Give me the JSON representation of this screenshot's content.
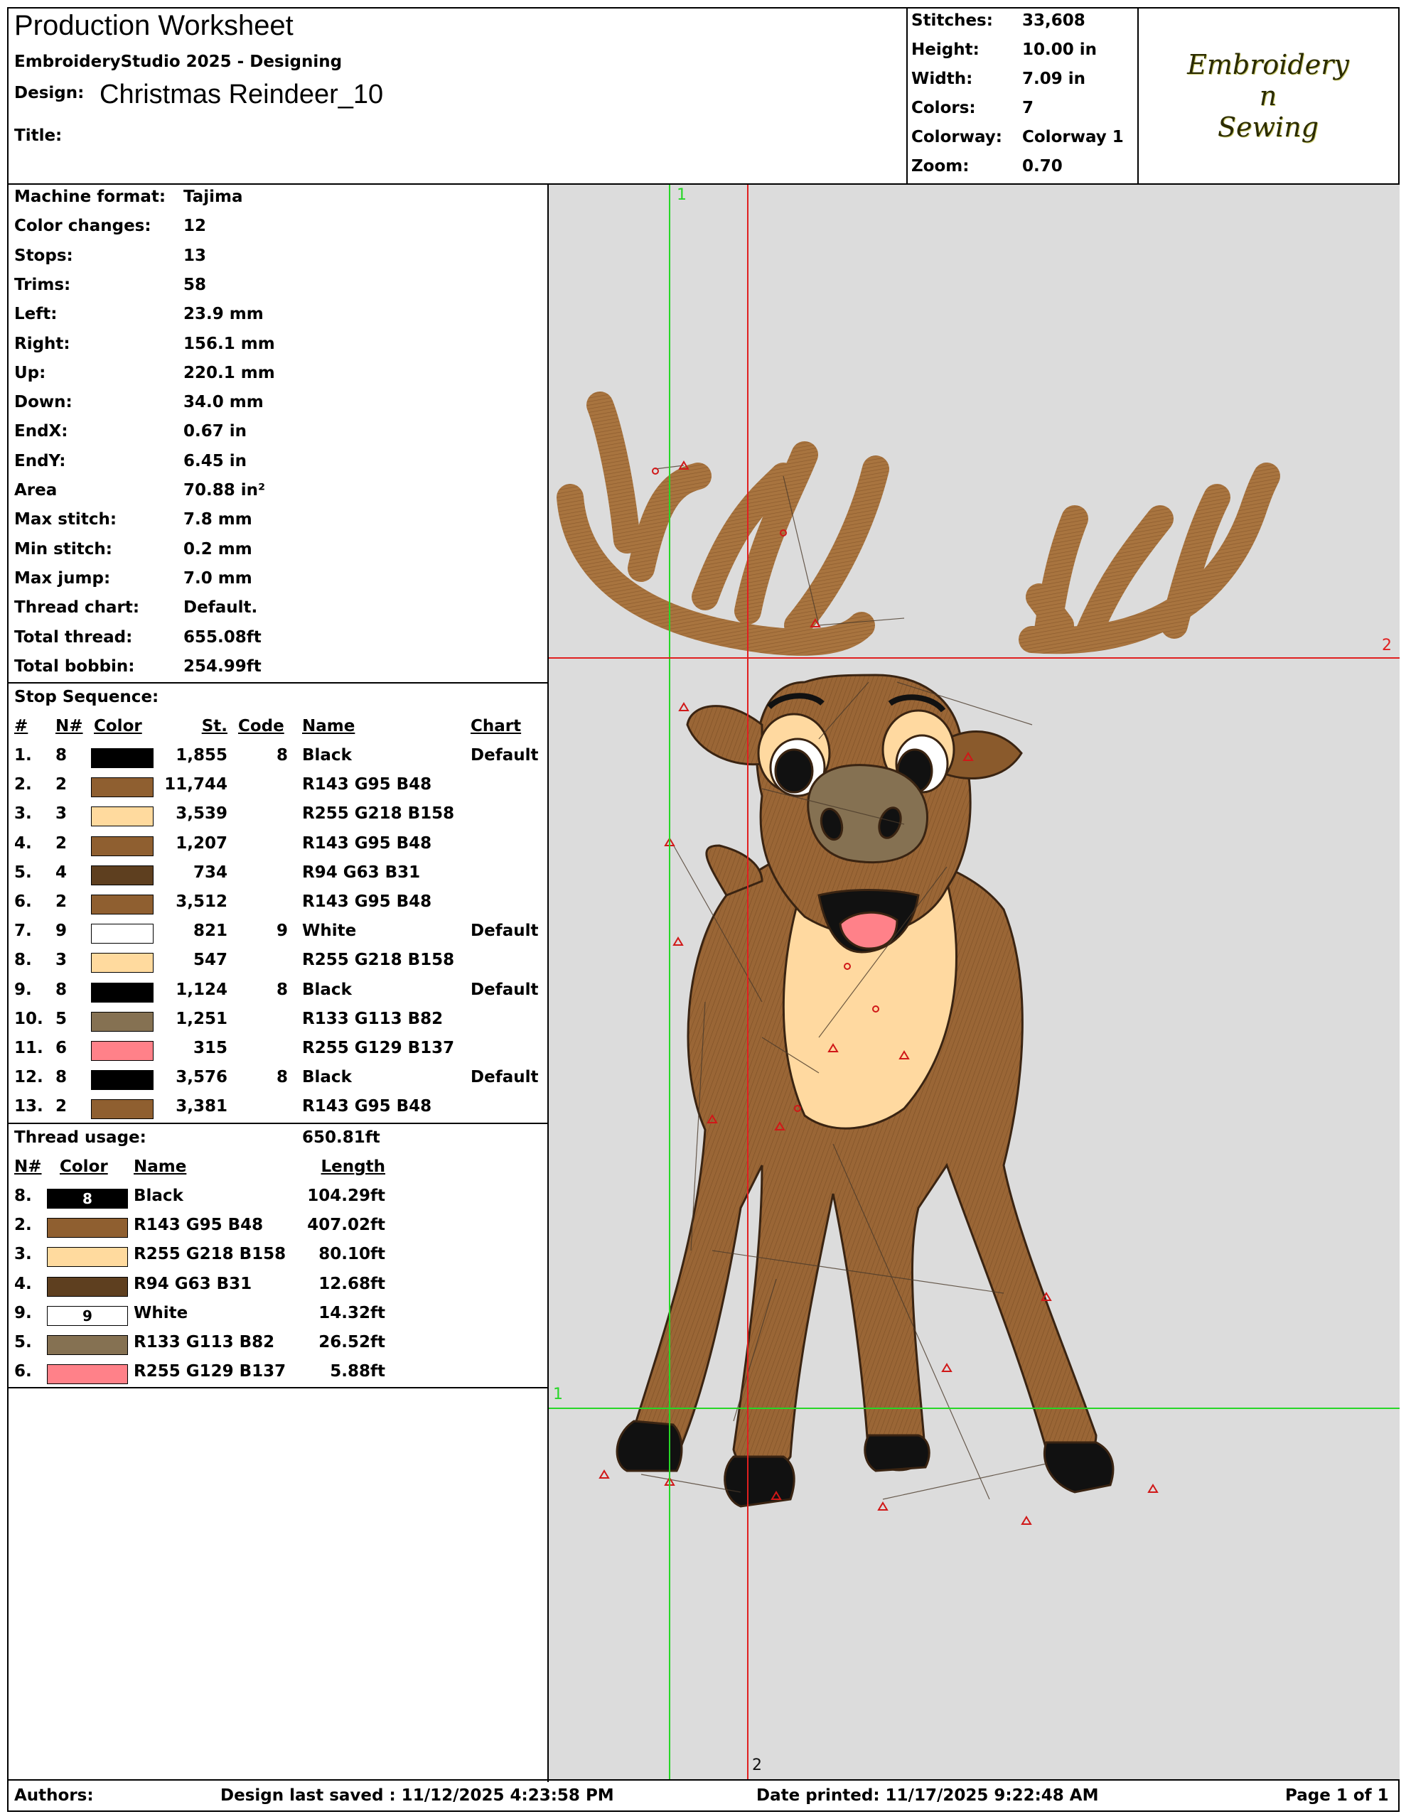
{
  "header": {
    "title": "Production Worksheet",
    "software": "EmbroideryStudio 2025 - Designing",
    "design_label": "Design:",
    "design_name": "Christmas Reindeer_10",
    "title_label": "Title:",
    "title_value": ""
  },
  "summary": {
    "stitches_label": "Stitches:",
    "stitches": "33,608",
    "height_label": "Height:",
    "height": "10.00 in",
    "width_label": "Width:",
    "width": "7.09 in",
    "colors_label": "Colors:",
    "colors": "7",
    "colorway_label": "Colorway:",
    "colorway": "Colorway 1",
    "zoom_label": "Zoom:",
    "zoom": "0.70"
  },
  "logo": {
    "line1": "Embroidery",
    "line2": "n",
    "line3": "Sewing"
  },
  "machine_info": [
    {
      "label": "Machine format:",
      "value": "Tajima"
    },
    {
      "label": "Color changes:",
      "value": "12"
    },
    {
      "label": "Stops:",
      "value": "13"
    },
    {
      "label": "Trims:",
      "value": "58"
    },
    {
      "label": "Left:",
      "value": "23.9 mm"
    },
    {
      "label": "Right:",
      "value": "156.1 mm"
    },
    {
      "label": "Up:",
      "value": "220.1 mm"
    },
    {
      "label": "Down:",
      "value": "34.0 mm"
    },
    {
      "label": "EndX:",
      "value": "0.67 in"
    },
    {
      "label": "EndY:",
      "value": "6.45 in"
    },
    {
      "label": "Area",
      "value": " 70.88 in²"
    },
    {
      "label": "Max stitch:",
      "value": "7.8 mm"
    },
    {
      "label": "Min stitch:",
      "value": "0.2 mm"
    },
    {
      "label": "Max jump:",
      "value": "7.0 mm"
    },
    {
      "label": "Thread chart:",
      "value": "Default."
    },
    {
      "label": "Total thread:",
      "value": "655.08ft"
    },
    {
      "label": "Total bobbin:",
      "value": "254.99ft"
    }
  ],
  "stop_sequence": {
    "title": "Stop Sequence:",
    "headers": {
      "num": "#",
      "n": "N#",
      "color": "Color",
      "st": "St.",
      "code": "Code",
      "name": "Name",
      "chart": "Chart"
    },
    "rows": [
      {
        "num": "1.",
        "n": "8",
        "color": "#000000",
        "st": "1,855",
        "code": "8",
        "name": "Black",
        "chart": "Default"
      },
      {
        "num": "2.",
        "n": "2",
        "color": "#8F5F30",
        "st": "11,744",
        "code": "",
        "name": "R143 G95 B48",
        "chart": ""
      },
      {
        "num": "3.",
        "n": "3",
        "color": "#FFDA9E",
        "st": "3,539",
        "code": "",
        "name": "R255 G218 B158",
        "chart": ""
      },
      {
        "num": "4.",
        "n": "2",
        "color": "#8F5F30",
        "st": "1,207",
        "code": "",
        "name": "R143 G95 B48",
        "chart": ""
      },
      {
        "num": "5.",
        "n": "4",
        "color": "#5E3F1F",
        "st": "734",
        "code": "",
        "name": "R94 G63 B31",
        "chart": ""
      },
      {
        "num": "6.",
        "n": "2",
        "color": "#8F5F30",
        "st": "3,512",
        "code": "",
        "name": "R143 G95 B48",
        "chart": ""
      },
      {
        "num": "7.",
        "n": "9",
        "color": "#FFFFFF",
        "st": "821",
        "code": "9",
        "name": "White",
        "chart": "Default"
      },
      {
        "num": "8.",
        "n": "3",
        "color": "#FFDA9E",
        "st": "547",
        "code": "",
        "name": "R255 G218 B158",
        "chart": ""
      },
      {
        "num": "9.",
        "n": "8",
        "color": "#000000",
        "st": "1,124",
        "code": "8",
        "name": "Black",
        "chart": "Default"
      },
      {
        "num": "10.",
        "n": "5",
        "color": "#857152",
        "st": "1,251",
        "code": "",
        "name": "R133 G113 B82",
        "chart": ""
      },
      {
        "num": "11.",
        "n": "6",
        "color": "#FF8189",
        "st": "315",
        "code": "",
        "name": "R255 G129 B137",
        "chart": ""
      },
      {
        "num": "12.",
        "n": "8",
        "color": "#000000",
        "st": "3,576",
        "code": "8",
        "name": "Black",
        "chart": "Default"
      },
      {
        "num": "13.",
        "n": "2",
        "color": "#8F5F30",
        "st": "3,381",
        "code": "",
        "name": "R143 G95 B48",
        "chart": ""
      }
    ]
  },
  "thread_usage": {
    "title": "Thread usage:",
    "total": "650.81ft",
    "headers": {
      "n": "N#",
      "color": "Color",
      "name": "Name",
      "length": "Length"
    },
    "rows": [
      {
        "n": "8.",
        "color": "#000000",
        "code": "8",
        "code_color": "#ffffff",
        "name": "Black",
        "length": "104.29ft"
      },
      {
        "n": "2.",
        "color": "#8F5F30",
        "code": "",
        "code_color": "#000000",
        "name": "R143 G95 B48",
        "length": "407.02ft"
      },
      {
        "n": "3.",
        "color": "#FFDA9E",
        "code": "",
        "code_color": "#000000",
        "name": "R255 G218 B158",
        "length": "80.10ft"
      },
      {
        "n": "4.",
        "color": "#5E3F1F",
        "code": "",
        "code_color": "#000000",
        "name": "R94 G63 B31",
        "length": "12.68ft"
      },
      {
        "n": "9.",
        "color": "#FFFFFF",
        "code": "9",
        "code_color": "#000000",
        "name": "White",
        "length": "14.32ft"
      },
      {
        "n": "5.",
        "color": "#857152",
        "code": "",
        "code_color": "#000000",
        "name": "R133 G113 B82",
        "length": "26.52ft"
      },
      {
        "n": "6.",
        "color": "#FF8189",
        "code": "",
        "code_color": "#000000",
        "name": "R255 G129 B137",
        "length": "5.88ft"
      }
    ]
  },
  "canvas": {
    "guide1_label_top": "1",
    "guide1_label_left": "1",
    "guide2_label_right": "2",
    "guide2_label_bottom": "2",
    "colors": {
      "guide_green": "#27d627",
      "guide_red": "#e02020",
      "background": "#dcdcdc"
    }
  },
  "footer": {
    "authors_label": "Authors:",
    "saved": "Design last saved : 11/12/2025 4:23:58 PM",
    "printed": "Date printed: 11/17/2025 9:22:48 AM",
    "page": "Page 1 of 1"
  }
}
